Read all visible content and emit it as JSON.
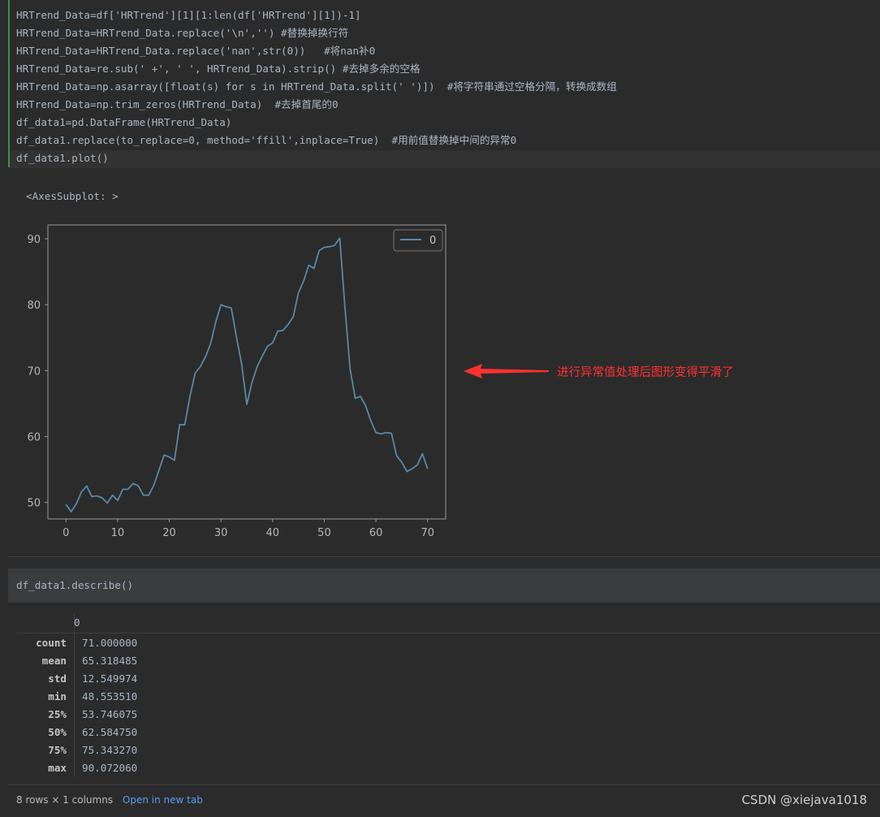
{
  "code_cell": {
    "lines": [
      "HRTrend_Data=df['HRTrend'][1][1:len(df['HRTrend'][1])-1]",
      "HRTrend_Data=HRTrend_Data.replace('\\n','') #替换掉换行符",
      "HRTrend_Data=HRTrend_Data.replace('nan',str(0))   #将nan补0",
      "HRTrend_Data=re.sub(' +', ' ', HRTrend_Data).strip() #去掉多余的空格",
      "HRTrend_Data=np.asarray([float(s) for s in HRTrend_Data.split(' ')])  #将字符串通过空格分隔，转换成数组",
      "HRTrend_Data=np.trim_zeros(HRTrend_Data)  #去掉首尾的0",
      "df_data1=pd.DataFrame(HRTrend_Data)",
      "df_data1.replace(to_replace=0, method='ffill',inplace=True)  #用前值替换掉中间的异常0",
      "df_data1.plot()"
    ]
  },
  "output": {
    "label": "<AxesSubplot: >"
  },
  "annotation": "进行异常值处理后图形变得平滑了",
  "chart_data": {
    "type": "line",
    "x": [
      0,
      1,
      2,
      3,
      4,
      5,
      6,
      7,
      8,
      9,
      10,
      11,
      12,
      13,
      14,
      15,
      16,
      17,
      18,
      19,
      20,
      21,
      22,
      23,
      24,
      25,
      26,
      27,
      28,
      29,
      30,
      31,
      32,
      33,
      34,
      35,
      36,
      37,
      38,
      39,
      40,
      41,
      42,
      43,
      44,
      45,
      46,
      47,
      48,
      49,
      50,
      51,
      52,
      53,
      54,
      55,
      56,
      57,
      58,
      59,
      60,
      61,
      62,
      63,
      64,
      65,
      66,
      67,
      68,
      69,
      70
    ],
    "series": [
      {
        "name": "0",
        "values": [
          49.7,
          48.6,
          49.8,
          51.6,
          52.5,
          50.9,
          51.0,
          50.7,
          49.9,
          51.1,
          50.3,
          52.0,
          52.0,
          52.9,
          52.5,
          51.1,
          51.1,
          52.6,
          54.9,
          57.2,
          56.9,
          56.4,
          61.8,
          61.8,
          66.1,
          69.6,
          70.6,
          72.1,
          74.1,
          77.4,
          80.0,
          79.7,
          79.5,
          75.1,
          71.0,
          64.9,
          68.2,
          70.6,
          72.2,
          73.7,
          74.2,
          76.0,
          76.1,
          77.0,
          78.2,
          81.8,
          83.6,
          86.0,
          85.5,
          88.2,
          88.7,
          88.8,
          89.0,
          90.1,
          79.6,
          70.2,
          65.8,
          66.1,
          64.7,
          62.4,
          60.6,
          60.4,
          60.6,
          60.5,
          57.1,
          56.1,
          54.7,
          55.1,
          55.7,
          57.4,
          55.1
        ]
      }
    ],
    "xlim": [
      -3.5,
      73.5
    ],
    "ylim": [
      47.5,
      92.1
    ],
    "xticks": [
      "0",
      "10",
      "20",
      "30",
      "40",
      "50",
      "60",
      "70"
    ],
    "yticks": [
      "50",
      "60",
      "70",
      "80",
      "90"
    ],
    "legend": "top-right",
    "grid": false,
    "line_color": "#5b87a8"
  },
  "code_cell2": {
    "line": "df_data1.describe()"
  },
  "table": {
    "column": "0",
    "rows": [
      {
        "label": "count",
        "value": "71.000000"
      },
      {
        "label": "mean",
        "value": "65.318485"
      },
      {
        "label": "std",
        "value": "12.549974"
      },
      {
        "label": "min",
        "value": "48.553510"
      },
      {
        "label": "25%",
        "value": "53.746075"
      },
      {
        "label": "50%",
        "value": "62.584750"
      },
      {
        "label": "75%",
        "value": "75.343270"
      },
      {
        "label": "max",
        "value": "90.072060"
      }
    ]
  },
  "footer": {
    "summary": "8 rows × 1 columns",
    "link": "Open in new tab"
  },
  "watermark": "CSDN @xiejava1018"
}
